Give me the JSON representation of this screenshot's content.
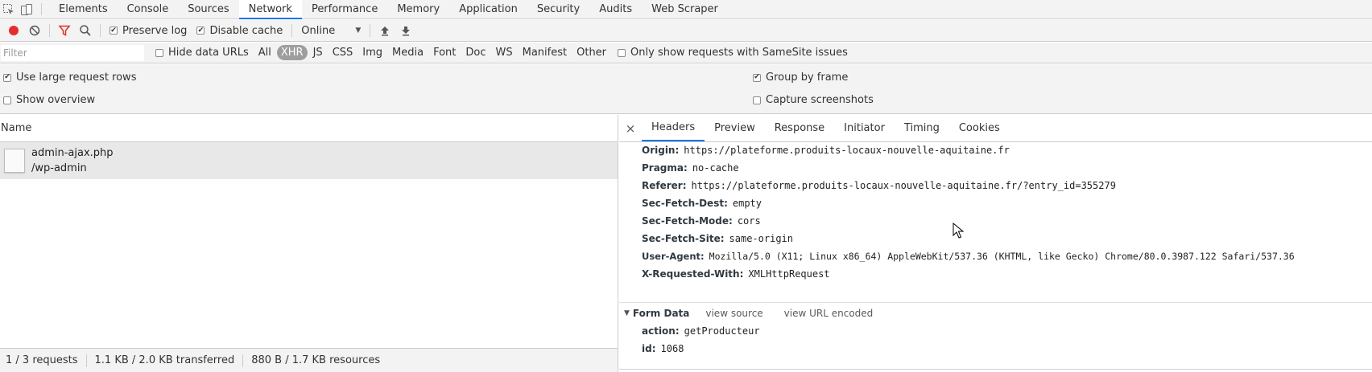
{
  "tabs": [
    "Elements",
    "Console",
    "Sources",
    "Network",
    "Performance",
    "Memory",
    "Application",
    "Security",
    "Audits",
    "Web Scraper"
  ],
  "active_tab": "Network",
  "toolbar": {
    "preserve_log": "Preserve log",
    "disable_cache": "Disable cache",
    "throttling": "Online"
  },
  "filter": {
    "placeholder": "Filter",
    "hide_data_urls": "Hide data URLs",
    "types": [
      "All",
      "XHR",
      "JS",
      "CSS",
      "Img",
      "Media",
      "Font",
      "Doc",
      "WS",
      "Manifest",
      "Other"
    ],
    "active_type": "XHR",
    "samesite": "Only show requests with SameSite issues"
  },
  "settings": {
    "large_rows": "Use large request rows",
    "show_overview": "Show overview",
    "group_by_frame": "Group by frame",
    "capture_screenshots": "Capture screenshots"
  },
  "list": {
    "name_header": "Name",
    "request": {
      "name": "admin-ajax.php",
      "path": "/wp-admin"
    }
  },
  "status": {
    "requests": "1 / 3 requests",
    "transferred": "1.1 KB / 2.0 KB transferred",
    "resources": "880 B / 1.7 KB resources"
  },
  "details": {
    "close": "×",
    "tabs": [
      "Headers",
      "Preview",
      "Response",
      "Initiator",
      "Timing",
      "Cookies"
    ],
    "active_tab": "Headers",
    "headers": [
      {
        "key": "Origin:",
        "value": "https://plateforme.produits-locaux-nouvelle-aquitaine.fr"
      },
      {
        "key": "Pragma:",
        "value": "no-cache"
      },
      {
        "key": "Referer:",
        "value": "https://plateforme.produits-locaux-nouvelle-aquitaine.fr/?entry_id=355279"
      },
      {
        "key": "Sec-Fetch-Dest:",
        "value": "empty"
      },
      {
        "key": "Sec-Fetch-Mode:",
        "value": "cors"
      },
      {
        "key": "Sec-Fetch-Site:",
        "value": "same-origin"
      },
      {
        "key": "User-Agent:",
        "value": "Mozilla/5.0 (X11; Linux x86_64) AppleWebKit/537.36 (KHTML, like Gecko) Chrome/80.0.3987.122 Safari/537.36"
      },
      {
        "key": "X-Requested-With:",
        "value": "XMLHttpRequest"
      }
    ],
    "form_data": {
      "title": "Form Data",
      "view_source": "view source",
      "view_url_encoded": "view URL encoded",
      "fields": [
        {
          "key": "action:",
          "value": "getProducteur"
        },
        {
          "key": "id:",
          "value": "1068"
        }
      ]
    }
  }
}
